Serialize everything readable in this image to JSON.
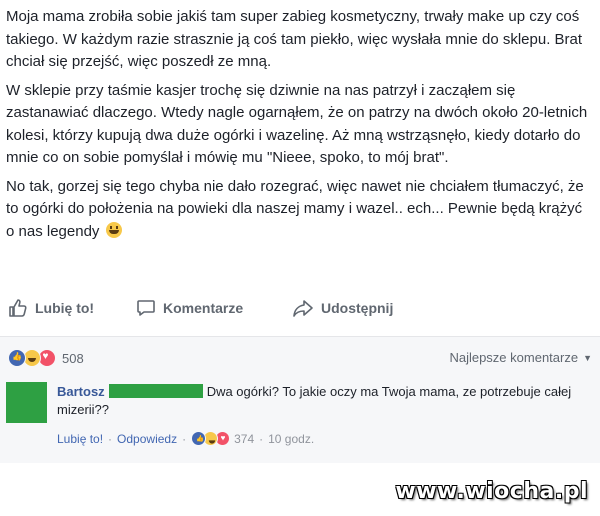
{
  "post": {
    "paragraphs": [
      "Moja mama zrobiła sobie jakiś tam super zabieg kosmetyczny, trwały make up czy coś takiego. W każdym razie strasznie ją coś tam piekło, więc wysłała mnie do sklepu. Brat chciał się przejść, więc poszedł ze mną.",
      "W sklepie przy taśmie kasjer trochę się dziwnie na nas patrzył i zacząłem się zastanawiać dlaczego. Wtedy nagle ogarnąłem, że on patrzy na dwóch około 20-letnich kolesi, którzy kupują dwa duże ogórki i wazelinę. Aż mną wstrząsnęło, kiedy dotarło do mnie co on sobie pomyślał i mówię mu \"Nieee, spoko, to mój brat\".",
      "No tak, gorzej się tego chyba nie dało rozegrać, więc nawet nie chciałem tłumaczyć, że to ogórki do położenia na powieki dla naszej mamy i wazel.. ech... Pewnie będą krążyć o nas legendy"
    ],
    "emoji_icon": "laughing-emoji"
  },
  "actions": {
    "like": "Lubię to!",
    "comment": "Komentarze",
    "share": "Udostępnij"
  },
  "reactions": {
    "icons": [
      "like-icon",
      "haha-icon",
      "love-icon"
    ],
    "count": "508"
  },
  "sort_label": "Najlepsze komentarze",
  "comment": {
    "author": "Bartosz",
    "text": "Dwa ogórki? To jakie oczy ma Twoja mama, ze potrzebuje całej mizerii??",
    "like_label": "Lubię to!",
    "reply_label": "Odpowiedz",
    "reaction_count": "374",
    "time": "10 godz."
  },
  "watermark": "www.wiocha.pl",
  "colors": {
    "link": "#385898",
    "censor_green": "#2ea043",
    "like_blue": "#4267b2",
    "love_red": "#f25268"
  }
}
